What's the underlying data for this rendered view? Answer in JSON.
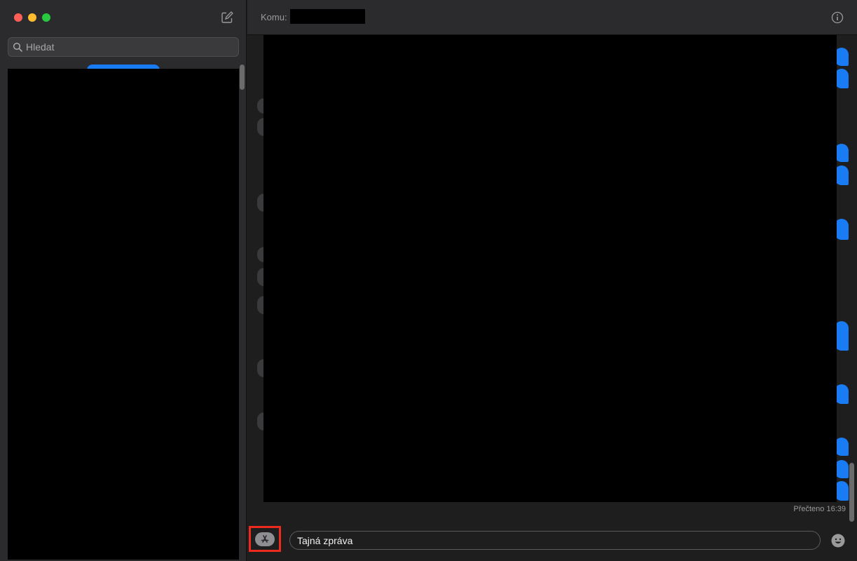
{
  "sidebar": {
    "search": {
      "placeholder": "Hledat",
      "value": ""
    },
    "compose_icon": "compose-icon"
  },
  "header": {
    "to_label": "Komu:",
    "info_icon": "info-icon"
  },
  "transcript": {
    "read_receipt": "Přečteno 16:39"
  },
  "compose": {
    "apps_icon": "app-store-icon",
    "message_value": "Tajná zpráva",
    "emoji_icon": "emoji-icon"
  },
  "colors": {
    "accent": "#1a7cf5",
    "highlight_border": "#ee2a1f",
    "sidebar_bg": "#2b2b2d",
    "main_bg": "#1e1e1e"
  }
}
